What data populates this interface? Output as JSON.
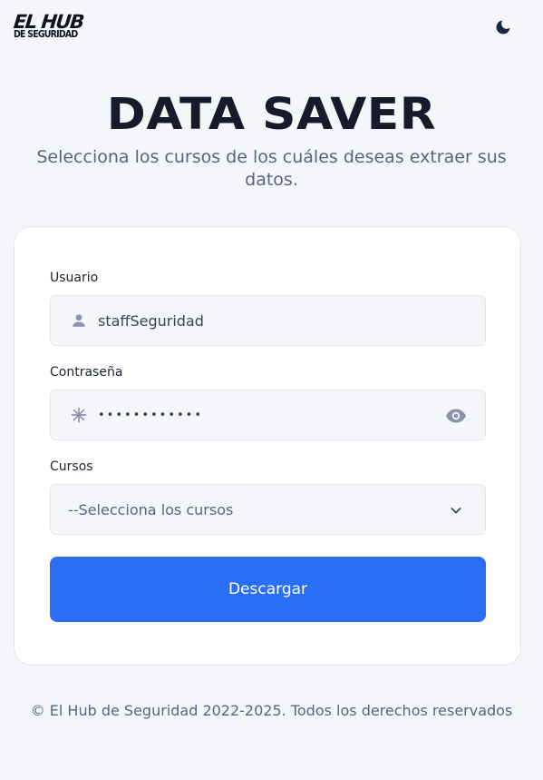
{
  "header": {
    "logo_line1": "EL HUB",
    "logo_line2": "DE SEGURIDAD",
    "theme_toggle_icon": "moon-icon"
  },
  "hero": {
    "title": "DATA SAVER",
    "subtitle": "Selecciona los cursos de los cuáles deseas extraer sus datos."
  },
  "form": {
    "username": {
      "label": "Usuario",
      "value": "staffSeguridad",
      "icon": "user-icon"
    },
    "password": {
      "label": "Contraseña",
      "value": "••••••••••••",
      "icon": "asterisk-icon",
      "toggle_icon": "eye-icon"
    },
    "courses": {
      "label": "Cursos",
      "selected": "--Selecciona los cursos",
      "icon": "chevron-down-icon"
    },
    "submit_label": "Descargar"
  },
  "footer": {
    "text": "© El Hub de Seguridad 2022-2025. Todos los derechos reservados"
  },
  "colors": {
    "background": "#f5f6fa",
    "accent": "#2a6ef6",
    "title": "#161b2b",
    "muted_text": "#566582"
  }
}
